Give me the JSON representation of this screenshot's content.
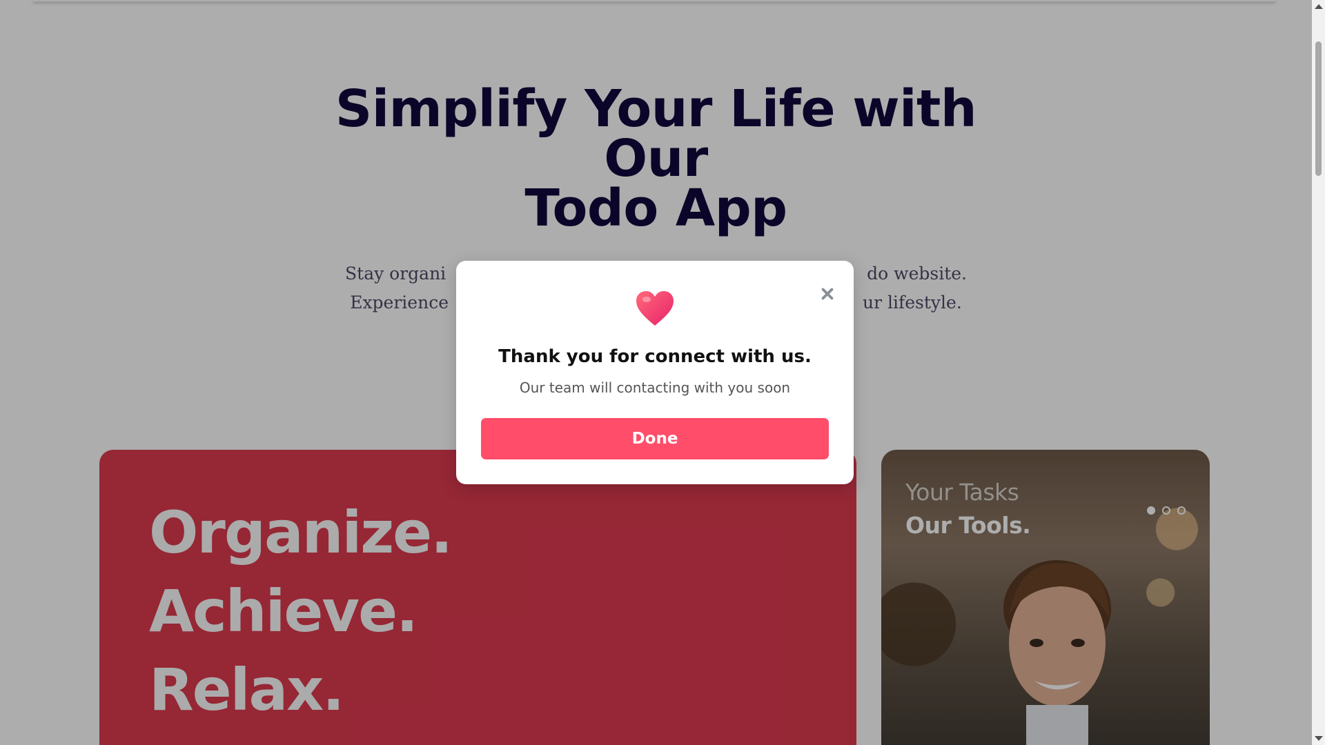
{
  "hero": {
    "title_lines": [
      "Simplify Your Life with",
      "Our",
      "Todo App"
    ],
    "subtitle_lines": [
      "Stay organi                                               do website.",
      "Experience                                                ur lifestyle."
    ]
  },
  "feature_card": {
    "words": [
      "Organize.",
      "Achieve.",
      "Relax."
    ],
    "color": "#de3a4f"
  },
  "photo_card": {
    "line1": "Your Tasks",
    "line2": "Our Tools.",
    "slide_count": 3,
    "active_slide": 1
  },
  "modal": {
    "icon": "heart-icon",
    "title": "Thank you for connect with us.",
    "message": "Our team will contacting with you soon",
    "button_label": "Done",
    "button_color": "#ff4d6a",
    "close_icon": "close-icon"
  }
}
